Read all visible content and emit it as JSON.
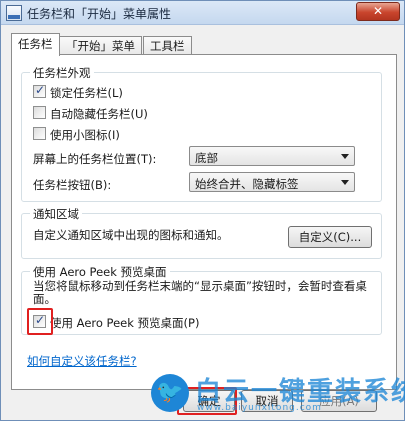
{
  "window": {
    "title": "任务栏和「开始」菜单属性",
    "close_symbol": "✕"
  },
  "tabs": [
    {
      "label": "任务栏",
      "active": true
    },
    {
      "label": "「开始」菜单",
      "active": false
    },
    {
      "label": "工具栏",
      "active": false
    }
  ],
  "appearance": {
    "legend": "任务栏外观",
    "options": [
      {
        "label": "锁定任务栏(L)",
        "checked": true
      },
      {
        "label": "自动隐藏任务栏(U)",
        "checked": false
      },
      {
        "label": "使用小图标(I)",
        "checked": false
      }
    ],
    "position_label": "屏幕上的任务栏位置(T):",
    "position_value": "底部",
    "buttons_label": "任务栏按钮(B):",
    "buttons_value": "始终合并、隐藏标签"
  },
  "notification": {
    "legend": "通知区域",
    "description": "自定义通知区域中出现的图标和通知。",
    "customize_label": "自定义(C)..."
  },
  "aero_peek": {
    "legend": "使用 Aero Peek 预览桌面",
    "description": "当您将鼠标移动到任务栏末端的“显示桌面”按钮时，会暂时查看桌面。",
    "checkbox_label": "使用 Aero Peek 预览桌面(P)",
    "checked": true
  },
  "help_link": "如何自定义该任务栏?",
  "buttons": {
    "ok": "确定",
    "cancel": "取消",
    "apply": "应用(A)"
  },
  "watermark": {
    "text": "白云一键重装系统",
    "url": "www.baiyunxitong.com",
    "color": "#1e86d6"
  },
  "colors": {
    "highlight": "#e02020",
    "link": "#0066cc",
    "close_button": "#c9452d"
  }
}
